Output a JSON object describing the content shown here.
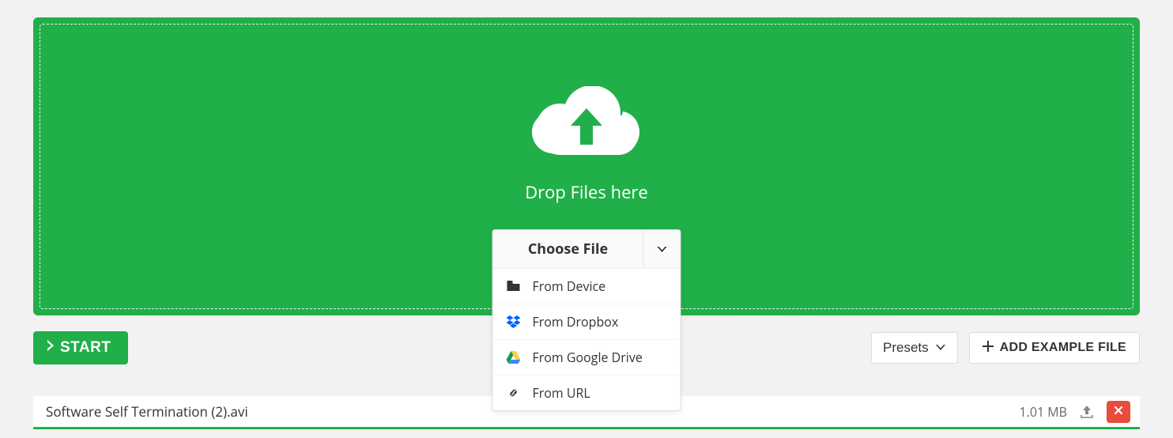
{
  "dropzone": {
    "drop_text": "Drop Files here"
  },
  "choose_file": {
    "label": "Choose File",
    "items": [
      {
        "label": "From Device"
      },
      {
        "label": "From Dropbox"
      },
      {
        "label": "From Google Drive"
      },
      {
        "label": "From URL"
      }
    ]
  },
  "toolbar": {
    "start_label": "START",
    "presets_label": "Presets",
    "add_example_label": "ADD EXAMPLE FILE"
  },
  "file_list": {
    "items": [
      {
        "name": "Software Self Termination (2).avi",
        "size": "1.01 MB"
      }
    ]
  }
}
